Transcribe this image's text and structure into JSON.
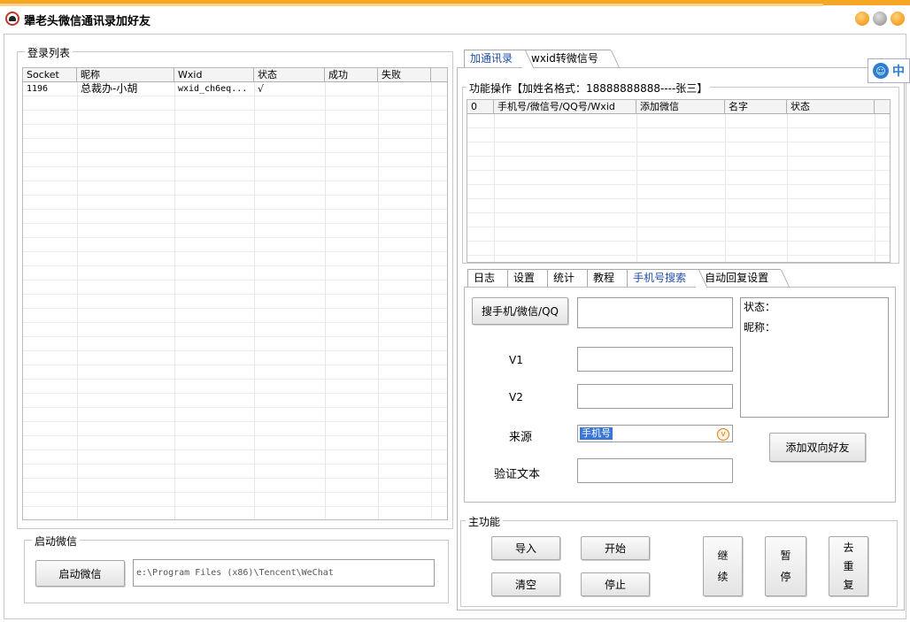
{
  "window": {
    "title": "犟老头微信通讯录加好友"
  },
  "login_list": {
    "title": "登录列表",
    "columns": [
      "Socket",
      "昵称",
      "Wxid",
      "状态",
      "成功",
      "失败"
    ],
    "rows": [
      {
        "socket": "1196",
        "nickname": "总裁办-小胡",
        "wxid": "wxid_ch6eq...",
        "status": "√",
        "success": "",
        "fail": ""
      }
    ]
  },
  "launch": {
    "title": "启动微信",
    "button_label": "启动微信",
    "path_value": "e:\\Program Files (x86)\\Tencent\\WeChat"
  },
  "top_tabs": [
    {
      "label": "加通讯录",
      "active": true
    },
    {
      "label": "wxid转微信号",
      "active": false
    }
  ],
  "function_ops": {
    "title": "功能操作【加姓名格式：18888888888----张三】",
    "columns": [
      "0",
      "手机号/微信号/QQ号/Wxid",
      "添加微信",
      "名字",
      "状态"
    ]
  },
  "bottom_tabs": [
    {
      "label": "日志",
      "active": false
    },
    {
      "label": "设置",
      "active": false
    },
    {
      "label": "统计",
      "active": false
    },
    {
      "label": "教程",
      "active": false
    },
    {
      "label": "手机号搜索",
      "active": true
    },
    {
      "label": "自动回复设置",
      "active": false
    }
  ],
  "search_panel": {
    "search_button": "搜手机/微信/QQ",
    "v1_label": "V1",
    "v2_label": "V2",
    "source_label": "来源",
    "source_selected": "手机号",
    "verify_label": "验证文本",
    "status_label": "状态：",
    "nickname_label": "昵称：",
    "add_friend_button": "添加双向好友"
  },
  "main_functions": {
    "title": "主功能",
    "import": "导入",
    "start": "开始",
    "clear": "清空",
    "stop": "停止",
    "resume": [
      "继",
      "续"
    ],
    "pause": [
      "暂",
      "停"
    ],
    "dedupe": [
      "去",
      "重",
      "复"
    ]
  },
  "ime": {
    "label": "中"
  }
}
